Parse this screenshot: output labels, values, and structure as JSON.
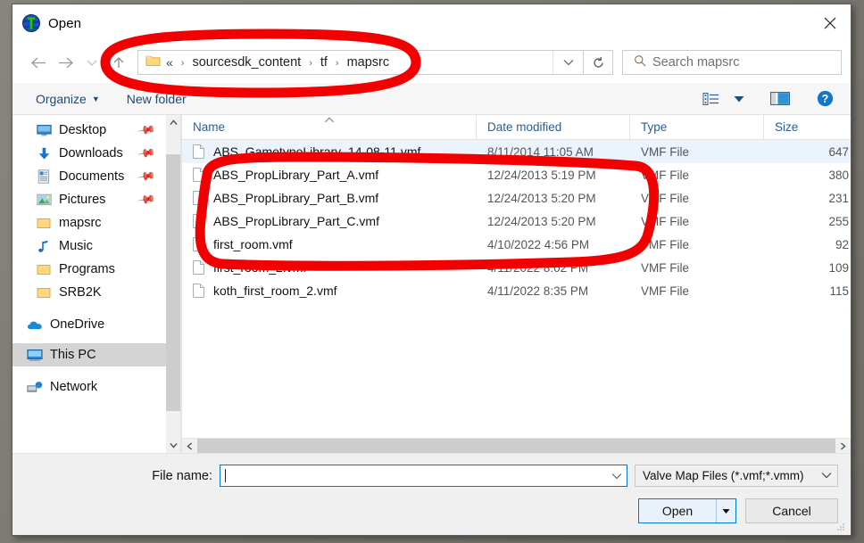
{
  "window": {
    "title": "Open",
    "title_icon": "hammer-globe-icon",
    "close_label": "✕"
  },
  "nav": {
    "back_icon": "arrow-left-icon",
    "forward_icon": "arrow-right-icon",
    "recent_icon": "chevron-down-icon",
    "up_icon": "arrow-up-icon",
    "address": {
      "folder_icon": "folder-icon",
      "overflow": "«",
      "crumbs": [
        "sourcesdk_content",
        "tf",
        "mapsrc"
      ],
      "separator": "›",
      "dropdown_icon": "chevron-down-icon"
    },
    "refresh_icon": "refresh-icon",
    "search": {
      "icon": "search-icon",
      "placeholder": "Search mapsrc",
      "value": ""
    }
  },
  "commandbar": {
    "organize": "Organize",
    "organize_caret": "▼",
    "new_folder": "New folder",
    "view_icon": "view-list-icon",
    "view_caret": "▼",
    "preview_icon": "preview-pane-icon",
    "help_icon": "help-icon"
  },
  "navpane": {
    "items": [
      {
        "label": "Desktop",
        "icon": "desktop-icon",
        "pinned": true,
        "selected": false
      },
      {
        "label": "Downloads",
        "icon": "download-icon",
        "pinned": true,
        "selected": false
      },
      {
        "label": "Documents",
        "icon": "document-icon",
        "pinned": true,
        "selected": false
      },
      {
        "label": "Pictures",
        "icon": "pictures-icon",
        "pinned": true,
        "selected": false
      },
      {
        "label": "mapsrc",
        "icon": "folder-icon",
        "pinned": false,
        "selected": false
      },
      {
        "label": "Music",
        "icon": "music-icon",
        "pinned": false,
        "selected": false
      },
      {
        "label": "Programs",
        "icon": "folder-icon",
        "pinned": false,
        "selected": false
      },
      {
        "label": "SRB2K",
        "icon": "folder-icon",
        "pinned": false,
        "selected": false
      }
    ],
    "groups": [
      {
        "label": "OneDrive",
        "icon": "onedrive-icon",
        "selected": false
      },
      {
        "label": "This PC",
        "icon": "thispc-icon",
        "selected": true
      },
      {
        "label": "Network",
        "icon": "network-icon",
        "selected": false
      }
    ],
    "scroll_up_icon": "chevron-up-icon",
    "scroll_down_icon": "chevron-down-icon"
  },
  "filelist": {
    "columns": [
      "Name",
      "Date modified",
      "Type",
      "Size"
    ],
    "sort_arrow": "▲",
    "sort_column": "Name",
    "rows": [
      {
        "name": "ABS_GametypeLibrary_14-08-11.vmf",
        "date": "8/11/2014 11:05 AM",
        "type": "VMF File",
        "size": "647",
        "selected": true,
        "obscured": false
      },
      {
        "name": "ABS_PropLibrary_Part_A.vmf",
        "date": "12/24/2013 5:19 PM",
        "type": "VMF File",
        "size": "380",
        "selected": false,
        "obscured": false
      },
      {
        "name": "ABS_PropLibrary_Part_B.vmf",
        "date": "12/24/2013 5:20 PM",
        "type": "VMF File",
        "size": "231",
        "selected": false,
        "obscured": false
      },
      {
        "name": "ABS_PropLibrary_Part_C.vmf",
        "date": "12/24/2013 5:20 PM",
        "type": "VMF File",
        "size": "255",
        "selected": false,
        "obscured": false
      },
      {
        "name": "first_room.vmf",
        "date": "4/10/2022 4:56 PM",
        "type": "VMF File",
        "size": "92",
        "selected": false,
        "obscured": true
      },
      {
        "name": "first_room_2.vmf",
        "date": "4/11/2022 8:02 PM",
        "type": "VMF File",
        "size": "109",
        "selected": false,
        "obscured": false
      },
      {
        "name": "koth_first_room_2.vmf",
        "date": "4/11/2022 8:35 PM",
        "type": "VMF File",
        "size": "115",
        "selected": false,
        "obscured": false
      }
    ],
    "hscroll_left_icon": "chevron-left-icon",
    "hscroll_right_icon": "chevron-right-icon"
  },
  "footer": {
    "filename_label": "File name:",
    "filename_value": "",
    "filename_dropdown_icon": "chevron-down-icon",
    "filter_value": "Valve Map Files (*.vmf;*.vmm)",
    "filter_caret": "⌄",
    "open_label": "Open",
    "open_split_caret": "▼",
    "cancel_label": "Cancel",
    "resize_grip_icon": "resize-grip-icon"
  },
  "annotations": {
    "color": "#f20000",
    "shapes": [
      {
        "name": "address-bar-circle",
        "target": "address-bar"
      },
      {
        "name": "file-rows-circle",
        "target": "first-four-rows"
      }
    ]
  }
}
